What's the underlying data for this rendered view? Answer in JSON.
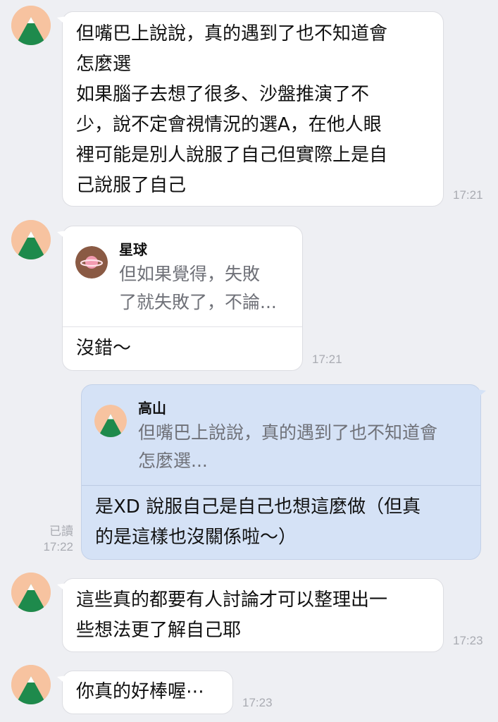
{
  "messages": [
    {
      "text": "但嘴巴上說說，真的遇到了也不知道會\n怎麼選\n如果腦子去想了很多、沙盤推演了不\n少，說不定會視情況的選A，在他人眼\n裡可能是別人說服了自己但實際上是自\n己說服了自己",
      "time": "17:21"
    },
    {
      "reply_to_name": "星球",
      "reply_quote": "但如果覺得，失敗\n了就失敗了，不論...",
      "text": "沒錯～",
      "time": "17:21"
    },
    {
      "reply_to_name": "高山",
      "reply_quote": "但嘴巴上說說，真的遇到了也不知道會\n怎麼選...",
      "text": "是XD 說服自己是自己也想這麼做（但真\n的是這樣也沒關係啦～）",
      "read_label": "已讀",
      "time": "17:22"
    },
    {
      "text": "這些真的都要有人討論才可以整理出一\n些想法更了解自己耶",
      "time": "17:23"
    },
    {
      "text": "你真的好棒喔⋯",
      "time": "17:23"
    }
  ],
  "icons": {
    "contact_avatar": "mountain-avatar-icon",
    "planet_avatar": "planet-avatar-icon"
  },
  "colors": {
    "background": "#eeeff3",
    "incoming_bubble": "#ffffff",
    "outgoing_bubble": "#d5e2f6",
    "avatar_bg": "#f7c3a0",
    "mountain_green": "#1e8a4c",
    "planet_brown": "#8a5a44"
  }
}
